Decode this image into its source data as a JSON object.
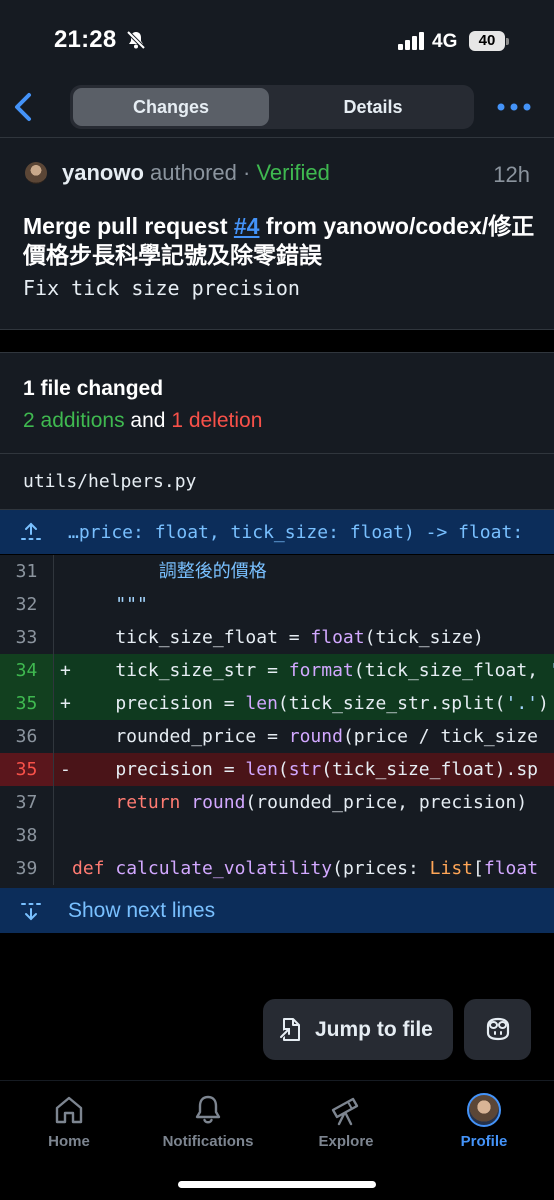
{
  "status": {
    "time": "21:28",
    "network": "4G",
    "battery": "40"
  },
  "nav": {
    "tabs": [
      {
        "label": "Changes",
        "active": true
      },
      {
        "label": "Details",
        "active": false
      }
    ]
  },
  "commit": {
    "author": "yanowo",
    "authored_text": "authored",
    "separator": "·",
    "verified": "Verified",
    "age": "12h",
    "title_prefix": "Merge pull request ",
    "title_link": "#4",
    "title_suffix": " from yanowo/codex/修正價格步長科學記號及除零錯誤",
    "subtitle": "Fix tick size precision"
  },
  "summary": {
    "files_changed": "1 file changed",
    "additions": "2 additions",
    "and": "and",
    "deletions": "1 deletion"
  },
  "file": {
    "name": "utils/helpers.py"
  },
  "hunk": {
    "header": "…price: float, tick_size: float) -> float:"
  },
  "diff": {
    "rows": [
      {
        "num": "31",
        "marker": "",
        "type": "context",
        "code": "        調整後的價格"
      },
      {
        "num": "32",
        "marker": "",
        "type": "context",
        "code": "    \"\"\""
      },
      {
        "num": "33",
        "marker": "",
        "type": "context",
        "code": "    tick_size_float = float(tick_size)"
      },
      {
        "num": "34",
        "marker": "+",
        "type": "added",
        "code": "    tick_size_str = format(tick_size_float, '"
      },
      {
        "num": "35",
        "marker": "+",
        "type": "added",
        "code": "    precision = len(tick_size_str.split('.')"
      },
      {
        "num": "36",
        "marker": "",
        "type": "context",
        "code": "    rounded_price = round(price / tick_size"
      },
      {
        "num": "35",
        "marker": "-",
        "type": "deleted",
        "code": "    precision = len(str(tick_size_float).sp"
      },
      {
        "num": "37",
        "marker": "",
        "type": "context",
        "code": "    return round(rounded_price, precision)"
      },
      {
        "num": "38",
        "marker": "",
        "type": "context",
        "code": ""
      },
      {
        "num": "39",
        "marker": "",
        "type": "context",
        "code": "def calculate_volatility(prices: List[float"
      }
    ]
  },
  "show_next": "Show next lines",
  "actions": {
    "jump_label": "Jump to file"
  },
  "tabbar": {
    "items": [
      {
        "label": "Home",
        "icon": "home-icon",
        "active": false
      },
      {
        "label": "Notifications",
        "icon": "bell-icon",
        "active": false
      },
      {
        "label": "Explore",
        "icon": "telescope-icon",
        "active": false
      },
      {
        "label": "Profile",
        "icon": "avatar",
        "active": true
      }
    ]
  },
  "colors": {
    "accent": "#4493f8",
    "added": "#3fb950",
    "deleted": "#f85149",
    "background": "#161b22"
  }
}
